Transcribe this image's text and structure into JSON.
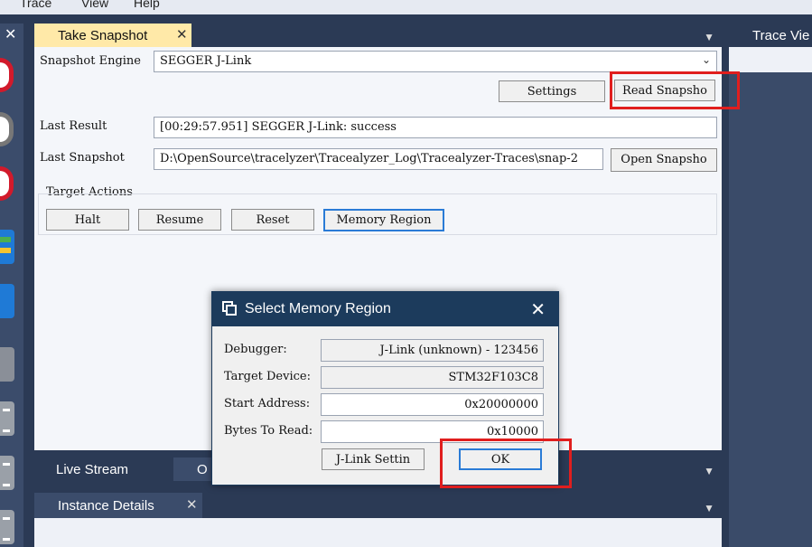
{
  "menubar": {
    "items": [
      "Trace",
      "View",
      "Help"
    ]
  },
  "main_tab": {
    "label": "Take Snapshot",
    "close": "✕"
  },
  "right_panel": {
    "tab_label": "Trace Vie"
  },
  "snapshot": {
    "engine_label": "Snapshot Engine",
    "engine_value": "SEGGER J-Link",
    "settings_button": "Settings",
    "read_button": "Read Snapsho",
    "last_result_label": "Last Result",
    "last_result_value": "[00:29:57.951] SEGGER J-Link: success",
    "last_snapshot_label": "Last Snapshot",
    "last_snapshot_value": "D:\\OpenSource\\tracelyzer\\Tracealyzer_Log\\Tracealyzer-Traces\\snap-2",
    "open_button": "Open Snapsho",
    "target_actions_label": "Target Actions",
    "actions": [
      "Halt",
      "Resume",
      "Reset",
      "Memory Region"
    ]
  },
  "bottom": {
    "tabs": [
      "Live Stream",
      "O"
    ],
    "instance_tab": "Instance Details",
    "instance_close": "✕"
  },
  "dialog": {
    "title": "Select Memory Region",
    "close": "✕",
    "debugger_label": "Debugger:",
    "debugger_value": "J-Link (unknown) - 123456",
    "device_label": "Target Device:",
    "device_value": "STM32F103C8",
    "start_label": "Start Address:",
    "start_value": "0x20000000",
    "bytes_label": "Bytes To Read:",
    "bytes_value": "0x10000",
    "jlink_button": "J-Link Settin",
    "ok_button": "OK"
  },
  "colors": {
    "accent_tab": "#ffe9a8",
    "dark_panel": "#2b3a55",
    "dialog_title": "#1c3b5c",
    "highlight": "#e01e1e"
  },
  "icons": [
    "close-icon",
    "chevron-down-icon",
    "record-icon",
    "stop-icon",
    "chart-icon",
    "tv-icon",
    "list-icon",
    "dialog-icon"
  ]
}
